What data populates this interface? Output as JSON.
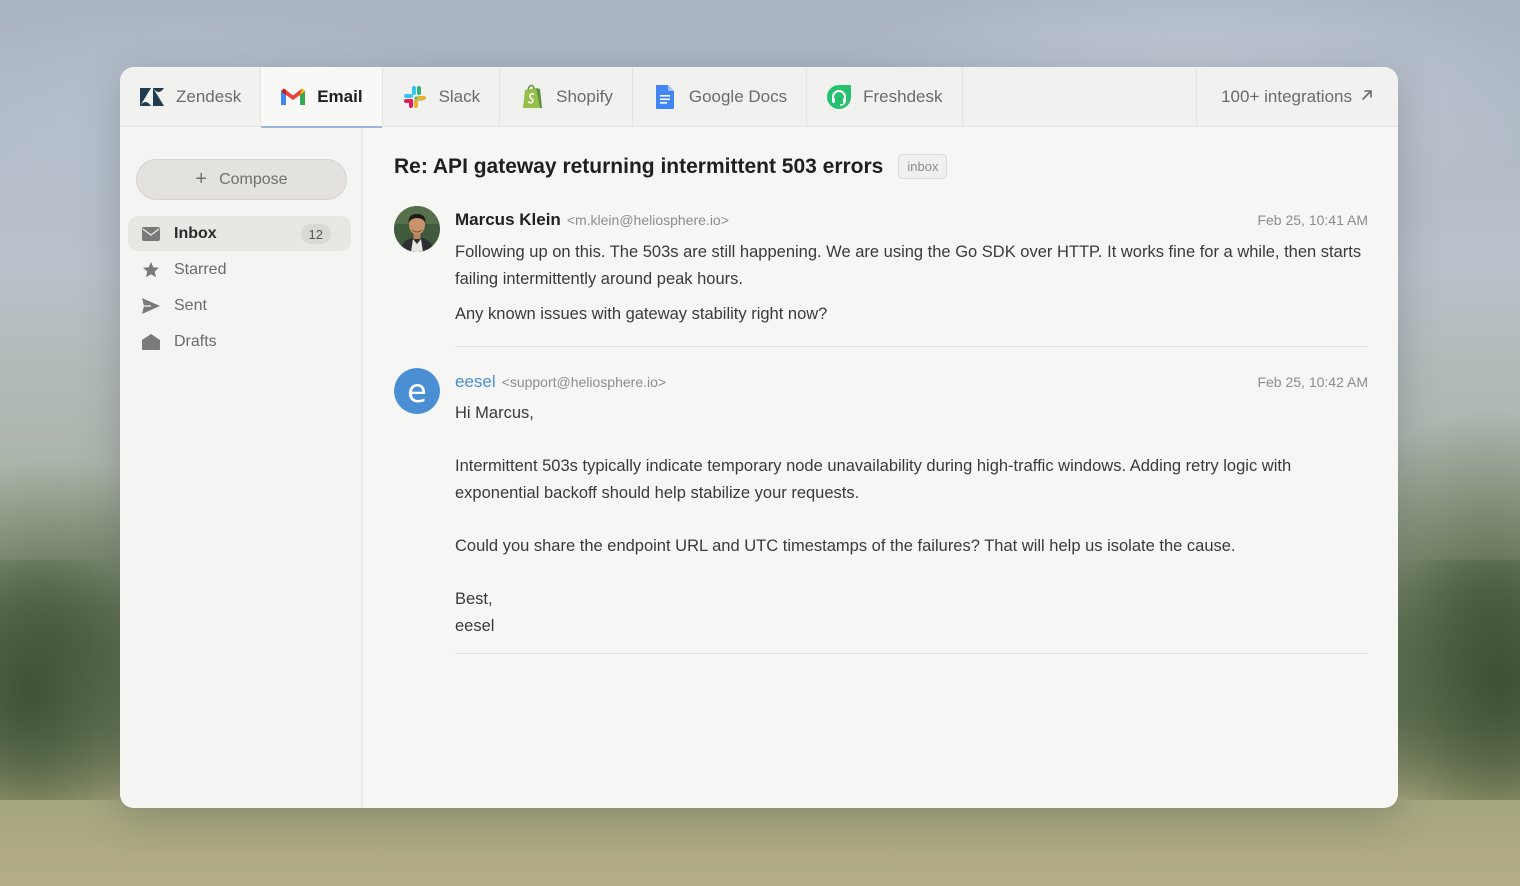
{
  "tabs": [
    {
      "label": "Zendesk",
      "icon": "zendesk-icon",
      "active": false
    },
    {
      "label": "Email",
      "icon": "gmail-icon",
      "active": true
    },
    {
      "label": "Slack",
      "icon": "slack-icon",
      "active": false
    },
    {
      "label": "Shopify",
      "icon": "shopify-icon",
      "active": false
    },
    {
      "label": "Google Docs",
      "icon": "google-docs-icon",
      "active": false
    },
    {
      "label": "Freshdesk",
      "icon": "freshdesk-icon",
      "active": false
    }
  ],
  "integrations_link": {
    "label": "100+ integrations",
    "icon": "arrow-up-right-icon"
  },
  "sidebar": {
    "compose_label": "Compose",
    "items": [
      {
        "label": "Inbox",
        "icon": "mail-icon",
        "count": "12",
        "active": true
      },
      {
        "label": "Starred",
        "icon": "star-icon",
        "active": false
      },
      {
        "label": "Sent",
        "icon": "send-icon",
        "active": false
      },
      {
        "label": "Drafts",
        "icon": "drafts-icon",
        "active": false
      }
    ]
  },
  "thread": {
    "subject": "Re: API gateway returning intermittent 503 errors",
    "label": "inbox",
    "messages": [
      {
        "sender": "Marcus Klein",
        "email": "<m.klein@heliosphere.io>",
        "date": "Feb 25, 10:41 AM",
        "paragraphs": [
          "Following up on this. The 503s are still happening. We are using the Go SDK over HTTP. It works fine for a while, then starts failing intermittently around peak hours.",
          "Any known issues with gateway stability right now?"
        ]
      },
      {
        "sender": "eesel",
        "email": "<support@heliosphere.io>",
        "date": "Feb 25, 10:42 AM",
        "paragraphs": [
          "Hi Marcus,",
          "Intermittent 503s typically indicate temporary node unavailability during high-traffic windows. Adding retry logic with exponential backoff should help stabilize your requests.",
          "Could you share the endpoint URL and UTC timestamps of the failures? That will help us isolate the cause.",
          "Best,",
          "eesel"
        ]
      }
    ]
  },
  "colors": {
    "accent_blue": "#4a8fd4",
    "active_tab_underline": "#9bb8db",
    "window_bg": "#f6f6f4"
  }
}
